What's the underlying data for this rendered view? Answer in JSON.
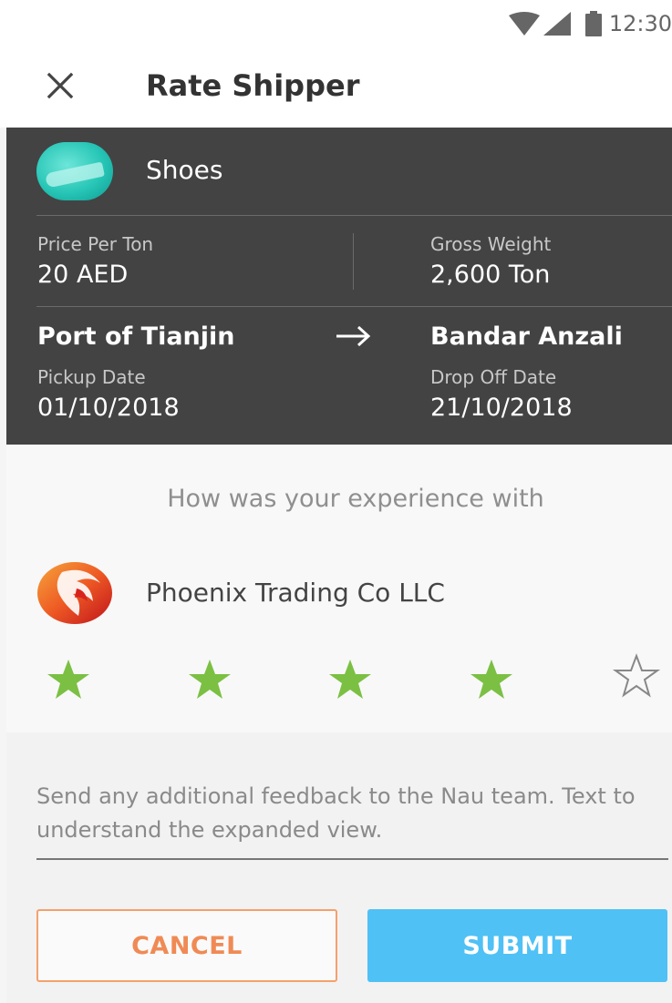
{
  "status_bar": {
    "time": "12:30"
  },
  "app_bar": {
    "title": "Rate Shipper",
    "close_icon": "close-icon"
  },
  "shipment": {
    "product_name": "Shoes",
    "price_label": "Price Per Ton",
    "price_value": "20 AED",
    "weight_label": "Gross Weight",
    "weight_value": "2,600 Ton",
    "origin": "Port of Tianjin",
    "destination": "Bandar Anzali",
    "pickup_label": "Pickup Date",
    "pickup_date": "01/10/2018",
    "dropoff_label": "Drop Off Date",
    "dropoff_date": "21/10/2018"
  },
  "rating": {
    "question": "How was your experience with",
    "company_name": "Phoenix Trading Co LLC",
    "stars_selected": 4,
    "stars_total": 5,
    "star_color": "#7bc043"
  },
  "feedback": {
    "placeholder": "Send any additional feedback to the Nau team. Text to understand the expanded view."
  },
  "actions": {
    "cancel_label": "CANCEL",
    "submit_label": "SUBMIT",
    "cancel_color": "#f08a55",
    "submit_color": "#4fc1f5"
  }
}
